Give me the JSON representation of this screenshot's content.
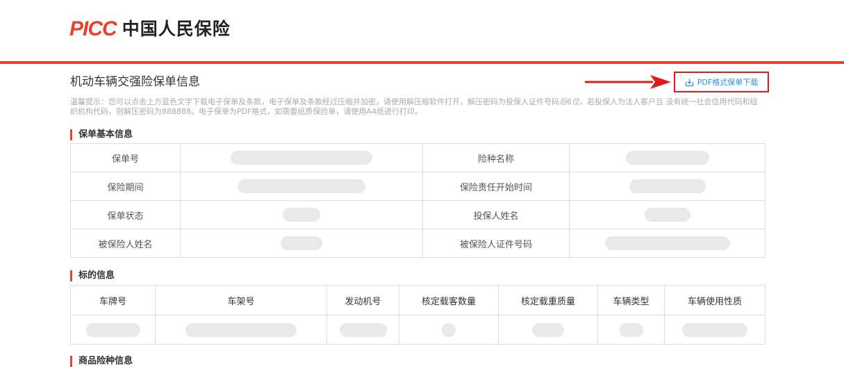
{
  "brand": {
    "logo_en": "PICC",
    "logo_cn": "中国人民保险"
  },
  "page": {
    "title": "机动车辆交强险保单信息"
  },
  "download": {
    "label": "PDF格式保单下载",
    "icon": "download-icon"
  },
  "tip": {
    "text_a": "温馨提示：您可以点击上方蓝色文字下载电子保单及条款，电子保单及条款经过压缩并加密，请使用解压缩软件打开，解压密码为投保人证件号码",
    "text_em": "后6位",
    "text_b": "，若投保人为法人客户且 没有统一社会信用代码和组织机构代码，则解压密码为888888。电子保单为PDF格式，如需要纸质保险单，请使用A4纸进行打印。"
  },
  "sections": {
    "basic": "保单基本信息",
    "subject": "标的信息",
    "product": "商品险种信息"
  },
  "basic_rows": [
    {
      "left_label": "保单号",
      "right_label": "险种名称"
    },
    {
      "left_label": "保险期间",
      "right_label": "保险责任开始时间"
    },
    {
      "left_label": "保单状态",
      "right_label": "投保人姓名"
    },
    {
      "left_label": "被保险人姓名",
      "right_label": "被保险人证件号码"
    }
  ],
  "subject_headers": [
    "车牌号",
    "车架号",
    "发动机号",
    "核定载客数量",
    "核定载重质量",
    "车辆类型",
    "车辆使用性质"
  ],
  "colors": {
    "brand_red": "#e8412f",
    "link_blue": "#2d8cf0",
    "highlight_red": "#e0191b"
  }
}
